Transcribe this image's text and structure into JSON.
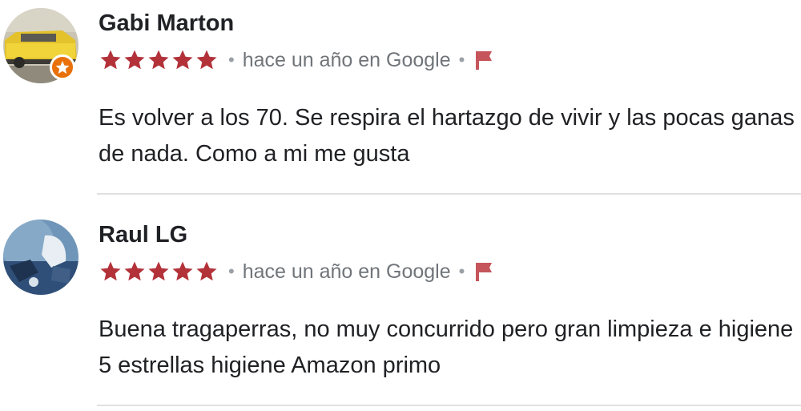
{
  "reviews": [
    {
      "author": "Gabi Marton",
      "rating": 5,
      "time": "hace un año en Google",
      "separator": "•",
      "text": "Es volver a los 70. Se respira el hartazgo de vivir y las pocas ganas de nada. Como a mi me gusta",
      "avatar_icon": "yellow-car-photo",
      "badge_icon": "local-guide-badge-icon"
    },
    {
      "author": "Raul LG",
      "rating": 5,
      "time": "hace un año en Google",
      "separator": "•",
      "text": "Buena tragaperras, no muy concurrido pero gran limpieza e higiene 5 estrellas higiene Amazon primo",
      "avatar_icon": "blue-illustration-photo"
    }
  ],
  "colors": {
    "star": "#b3323a",
    "flag": "#c5555b",
    "badge": "#e8710a",
    "meta_text": "#70757a",
    "divider": "#e0e0e0"
  }
}
